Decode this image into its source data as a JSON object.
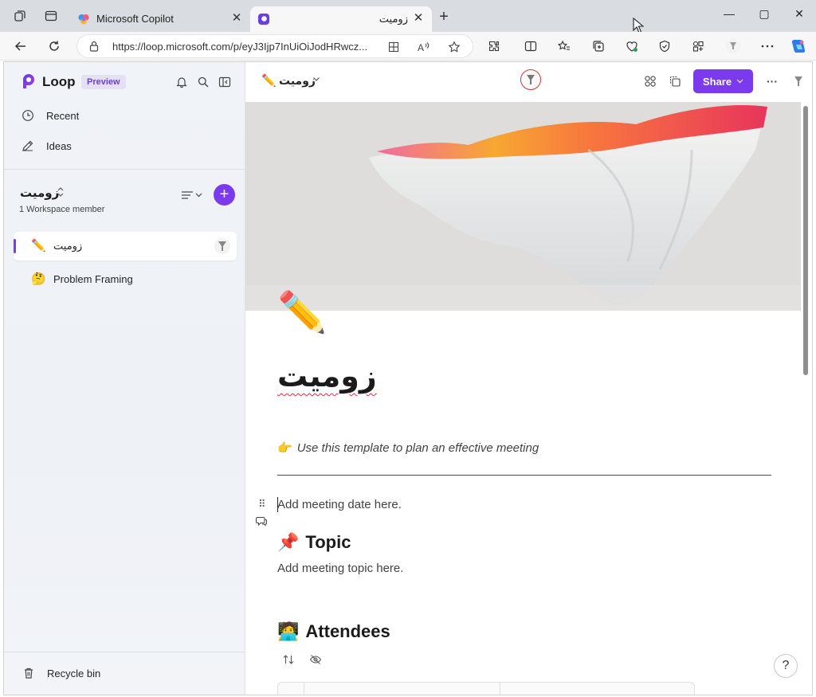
{
  "browser": {
    "tabs": [
      {
        "title": "Microsoft Copilot",
        "active": false
      },
      {
        "title": "زوميت",
        "active": true
      }
    ],
    "close_glyph": "✕",
    "new_tab_glyph": "+",
    "address": {
      "url": "https://loop.microsoft.com/p/eyJ3Ijp7InUiOiJodHRwcz..."
    },
    "window_controls": {
      "minimize": "—",
      "maximize": "▢",
      "close": "✕"
    },
    "toolbar_icons": [
      "back-icon",
      "refresh-icon",
      "extensions-icon",
      "split-screen-icon",
      "favorites-icon",
      "collections-icon",
      "health-icon",
      "browser-essentials-icon",
      "apps-icon",
      "profile-icon",
      "more-icon",
      "copilot-icon"
    ]
  },
  "sidebar": {
    "brand": "Loop",
    "badge": "Preview",
    "nav": [
      {
        "label": "Recent",
        "icon": "clock-icon"
      },
      {
        "label": "Ideas",
        "icon": "ideas-icon"
      }
    ],
    "workspace": {
      "name": "زوميت",
      "caret": "⌃⌄",
      "members": "1 Workspace member",
      "add": "+"
    },
    "pages": [
      {
        "emoji": "✏️",
        "title": "زوميت",
        "selected": true
      },
      {
        "emoji": "🤔",
        "title": "Problem Framing",
        "selected": false
      }
    ],
    "recycle_bin": "Recycle bin"
  },
  "header": {
    "page_title": "زوميت",
    "share_label": "Share",
    "more": "···"
  },
  "document": {
    "emoji": "✏️",
    "title": "زوميت",
    "hint_emoji": "👉",
    "hint": "Use this template to plan an effective meeting",
    "date_placeholder": "Add meeting date here.",
    "topic": {
      "emoji": "📌",
      "heading": "Topic",
      "body": "Add meeting topic here."
    },
    "attendees": {
      "emoji": "🧑‍💻",
      "heading": "Attendees"
    },
    "help": "?"
  },
  "colors": {
    "accent": "#7c3aed",
    "sidebar_bg": "#eef1f6",
    "spell_error": "#d13438"
  }
}
